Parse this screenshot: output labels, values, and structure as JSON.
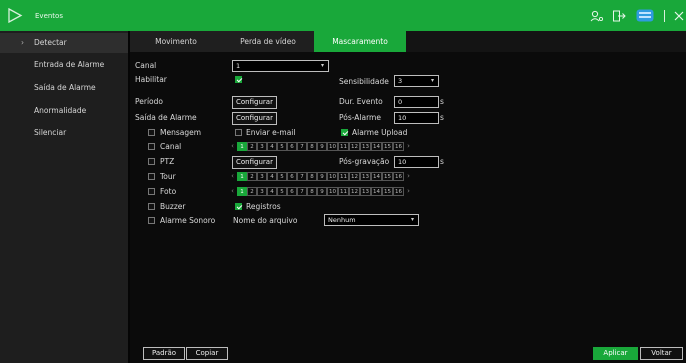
{
  "app": {
    "title": "Eventos"
  },
  "colors": {
    "accent": "#19a83a"
  },
  "sidebar": {
    "items": [
      {
        "label": "Detectar",
        "active": true
      },
      {
        "label": "Entrada de Alarme"
      },
      {
        "label": "Saída de Alarme"
      },
      {
        "label": "Anormalidade"
      },
      {
        "label": "Silenciar"
      }
    ]
  },
  "tabs": [
    {
      "label": "Movimento"
    },
    {
      "label": "Perda de vídeo"
    },
    {
      "label": "Mascaramento",
      "active": true
    }
  ],
  "form": {
    "canal_label": "Canal",
    "canal_value": "1",
    "habilitar_label": "Habilitar",
    "habilitar_checked": true,
    "sensibilidade_label": "Sensibilidade",
    "sensibilidade_value": "3",
    "periodo_label": "Período",
    "configurar_label": "Configurar",
    "dur_evento_label": "Dur. Evento",
    "dur_evento_value": "0",
    "unit_s": "s",
    "saida_alarme_label": "Saída de Alarme",
    "pos_alarme_label": "Pós-Alarme",
    "pos_alarme_value": "10",
    "mensagem_label": "Mensagem",
    "enviar_email_label": "Enviar e-mail",
    "alarme_upload_label": "Alarme Upload",
    "canal2_label": "Canal",
    "ptz_label": "PTZ",
    "pos_gravacao_label": "Pós-gravação",
    "pos_gravacao_value": "10",
    "tour_label": "Tour",
    "foto_label": "Foto",
    "buzzer_label": "Buzzer",
    "registros_label": "Registros",
    "alarme_sonoro_label": "Alarme Sonoro",
    "nome_arquivo_label": "Nome do arquivo",
    "nome_arquivo_value": "Nenhum",
    "channels": [
      "1",
      "2",
      "3",
      "4",
      "5",
      "6",
      "7",
      "8",
      "9",
      "10",
      "11",
      "12",
      "13",
      "14",
      "15",
      "16"
    ],
    "prev_glyph": "‹",
    "next_glyph": "›"
  },
  "footer": {
    "padrao": "Padrão",
    "copiar": "Copiar",
    "aplicar": "Aplicar",
    "voltar": "Voltar"
  }
}
